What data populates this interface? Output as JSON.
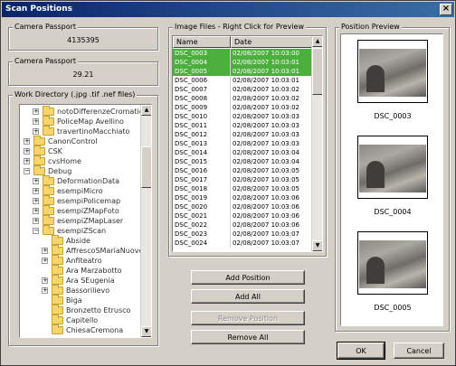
{
  "window": {
    "title": "Scan Positions",
    "close_glyph": "×"
  },
  "camera_passport_1": {
    "label": "Camera Passport",
    "value": "4135395"
  },
  "camera_passport_2": {
    "label": "Camera Passport",
    "value": "29.21"
  },
  "work_directory": {
    "label": "Work Directory (.jpg .tif .nef files)",
    "items": [
      {
        "label": "notoDifferenzeCromatiche",
        "icon": "folder-icon",
        "expander": "+"
      },
      {
        "label": "PoliceMap Avellino",
        "icon": "folder-icon",
        "expander": "+"
      },
      {
        "label": "travertinoMacchiato",
        "icon": "folder-icon",
        "expander": "+"
      },
      {
        "label": "CanonControl",
        "icon": "folder-icon",
        "expander": "+"
      },
      {
        "label": "CSK",
        "icon": "folder-icon",
        "expander": "+"
      },
      {
        "label": "cvsHome",
        "icon": "folder-icon",
        "expander": "+"
      },
      {
        "label": "Debug",
        "icon": "folder-icon",
        "expander": "−"
      },
      {
        "label": "DeformationData",
        "icon": "folder-icon",
        "expander": "+"
      },
      {
        "label": "esempiMicro",
        "icon": "folder-icon",
        "expander": "+"
      },
      {
        "label": "esempiPolicemap",
        "icon": "folder-icon",
        "expander": "+"
      },
      {
        "label": "esempiZMapFoto",
        "icon": "folder-icon",
        "expander": "+"
      },
      {
        "label": "esempiZMapLaser",
        "icon": "folder-icon",
        "expander": "+"
      },
      {
        "label": "esempiZScan",
        "icon": "folder-icon",
        "expander": "−"
      },
      {
        "label": "Abside",
        "icon": "folder-icon",
        "expander": ""
      },
      {
        "label": "AffrescoSMariaNuovo",
        "icon": "folder-icon",
        "expander": "+"
      },
      {
        "label": "Anfiteatro",
        "icon": "folder-icon",
        "expander": "+"
      },
      {
        "label": "Ara Marzabotto",
        "icon": "folder-icon",
        "expander": ""
      },
      {
        "label": "Ara SEugenia",
        "icon": "folder-icon",
        "expander": "+"
      },
      {
        "label": "Bassorilievo",
        "icon": "folder-icon",
        "expander": "+"
      },
      {
        "label": "Biga",
        "icon": "folder-icon",
        "expander": ""
      },
      {
        "label": "Bronzetto Etrusco",
        "icon": "folder-icon",
        "expander": ""
      },
      {
        "label": "Capitello",
        "icon": "folder-icon",
        "expander": ""
      },
      {
        "label": "ChiesaCremona",
        "icon": "folder-icon",
        "expander": ""
      }
    ]
  },
  "image_files": {
    "label": "Image Files - Right Click for Preview",
    "columns": {
      "name": "Name",
      "date": "Date"
    },
    "rows": [
      {
        "name": "DSC_0003",
        "date": "02/08/2007 10:03:00",
        "selected": true
      },
      {
        "name": "DSC_0004",
        "date": "02/08/2007 10:03:01",
        "selected": true
      },
      {
        "name": "DSC_0005",
        "date": "02/08/2007 10:03:01",
        "selected": true
      },
      {
        "name": "DSC_0006",
        "date": "02/08/2007 10:03:01",
        "selected": false
      },
      {
        "name": "DSC_0007",
        "date": "02/08/2007 10:03:02",
        "selected": false
      },
      {
        "name": "DSC_0008",
        "date": "02/08/2007 10:03:02",
        "selected": false
      },
      {
        "name": "DSC_0009",
        "date": "02/08/2007 10:03:02",
        "selected": false
      },
      {
        "name": "DSC_0010",
        "date": "02/08/2007 10:03:03",
        "selected": false
      },
      {
        "name": "DSC_0011",
        "date": "02/08/2007 10:03:03",
        "selected": false
      },
      {
        "name": "DSC_0012",
        "date": "02/08/2007 10:03:03",
        "selected": false
      },
      {
        "name": "DSC_0013",
        "date": "02/08/2007 10:03:03",
        "selected": false
      },
      {
        "name": "DSC_0014",
        "date": "02/08/2007 10:03:04",
        "selected": false
      },
      {
        "name": "DSC_0015",
        "date": "02/08/2007 10:03:04",
        "selected": false
      },
      {
        "name": "DSC_0016",
        "date": "02/08/2007 10:03:05",
        "selected": false
      },
      {
        "name": "DSC_0017",
        "date": "02/08/2007 10:03:05",
        "selected": false
      },
      {
        "name": "DSC_0018",
        "date": "02/08/2007 10:03:05",
        "selected": false
      },
      {
        "name": "DSC_0019",
        "date": "02/08/2007 10:03:06",
        "selected": false
      },
      {
        "name": "DSC_0020",
        "date": "02/08/2007 10:03:06",
        "selected": false
      },
      {
        "name": "DSC_0021",
        "date": "02/08/2007 10:03:06",
        "selected": false
      },
      {
        "name": "DSC_0022",
        "date": "02/08/2007 10:03:06",
        "selected": false
      },
      {
        "name": "DSC_0023",
        "date": "02/08/2007 10:03:07",
        "selected": false
      },
      {
        "name": "DSC_0024",
        "date": "02/08/2007 10:03:07",
        "selected": false
      }
    ]
  },
  "actions": {
    "add_position": "Add Position",
    "add_all": "Add All",
    "remove_position": "Remove Position",
    "remove_all": "Remove All"
  },
  "position_preview": {
    "label": "Position Preview",
    "thumbnails": [
      {
        "caption": "DSC_0003"
      },
      {
        "caption": "DSC_0004"
      },
      {
        "caption": "DSC_0005"
      }
    ]
  },
  "footer": {
    "ok": "OK",
    "cancel": "Cancel"
  },
  "colors": {
    "selection": "#4caf3d",
    "titlebar": "#0a246a",
    "folder": "#f6d66c"
  }
}
